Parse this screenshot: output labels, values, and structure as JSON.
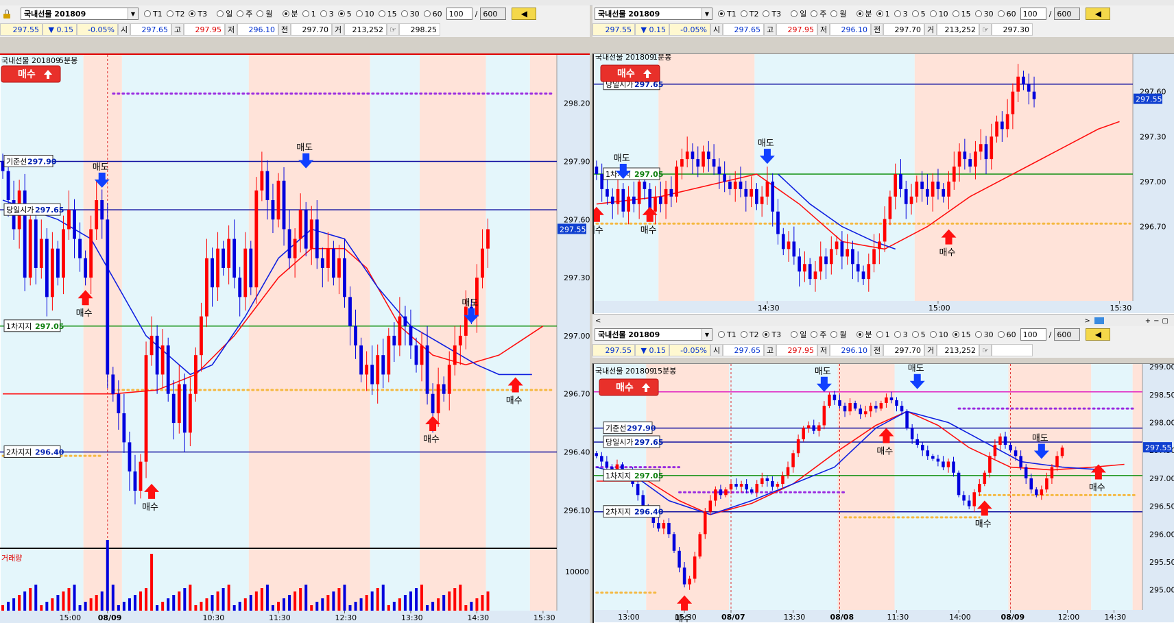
{
  "symbol": "국내선물 201809",
  "periods": [
    "T1",
    "T2",
    "T3",
    "일",
    "주",
    "월",
    "분",
    "1",
    "3",
    "5",
    "10",
    "15",
    "30",
    "60"
  ],
  "count": "100",
  "maxcount": "600",
  "quote": {
    "last": "297.55",
    "change": "▼ 0.15",
    "rate": "-0.05%",
    "open_label": "시",
    "open": "297.65",
    "high_label": "고",
    "high": "297.95",
    "low_label": "저",
    "low": "296.10",
    "prev_label": "전",
    "prev": "297.70",
    "vol_label": "거",
    "volume": "213,252"
  },
  "quote_extra_left": "298.25",
  "quote_extra_tr": "297.30",
  "buy_button": "매수",
  "sell_word": "매도",
  "buy_word": "매수",
  "volume_label": "거래량",
  "level_labels": {
    "base": {
      "name": "기준선",
      "value": "297.90"
    },
    "open": {
      "name": "당일시가",
      "value": "297.65"
    },
    "s1": {
      "name": "1차지지",
      "value": "297.05"
    },
    "s2": {
      "name": "2차지지",
      "value": "296.40"
    }
  },
  "charts": [
    {
      "id": "left",
      "title": "국내선물 201809",
      "interval": "5분봉",
      "selected_period": "5",
      "y_min": 295.85,
      "y_max": 298.45,
      "y_ticks": [
        "298.20",
        "297.90",
        "297.60",
        "297.30",
        "297.00",
        "296.70",
        "296.40",
        "296.10"
      ],
      "y_tick_values": [
        298.2,
        297.9,
        297.6,
        297.3,
        297.0,
        296.7,
        296.4,
        296.1
      ],
      "volume_tick": "10000",
      "x_labels": [
        {
          "text": "15:00",
          "i": 12
        },
        {
          "text": "08/09",
          "i": 19,
          "bold": true
        },
        {
          "text": "10:30",
          "i": 38
        },
        {
          "text": "11:30",
          "i": 50
        },
        {
          "text": "12:30",
          "i": 62
        },
        {
          "text": "13:30",
          "i": 74
        },
        {
          "text": "14:30",
          "i": 86
        },
        {
          "text": "15:30",
          "i": 98
        }
      ],
      "candles": [
        297.85,
        297.7,
        297.55,
        297.75,
        297.3,
        297.6,
        297.35,
        297.5,
        297.2,
        297.45,
        297.3,
        297.55,
        297.65,
        297.5,
        297.4,
        297.3,
        297.55,
        297.7,
        297.6,
        296.8,
        296.7,
        296.6,
        296.45,
        296.3,
        296.2,
        296.35,
        296.9,
        297.0,
        296.8,
        296.95,
        296.7,
        296.55,
        296.75,
        296.5,
        296.7,
        296.9,
        297.1,
        297.4,
        297.25,
        297.45,
        297.35,
        297.5,
        297.3,
        297.2,
        297.45,
        297.25,
        297.75,
        297.85,
        297.7,
        297.6,
        297.8,
        297.55,
        297.4,
        297.5,
        297.65,
        297.45,
        297.6,
        297.4,
        297.35,
        297.45,
        297.3,
        297.4,
        297.2,
        297.05,
        296.95,
        296.8,
        296.85,
        296.75,
        296.9,
        296.8,
        297.0,
        296.95,
        297.1,
        297.05,
        296.95,
        296.85,
        296.95,
        296.7,
        296.6,
        296.75,
        296.7,
        296.85,
        296.95,
        297.0,
        297.15,
        297.1,
        297.3,
        297.45,
        297.55
      ],
      "ma_red": [
        [
          0,
          296.7
        ],
        [
          20,
          296.7
        ],
        [
          28,
          296.72
        ],
        [
          35,
          296.8
        ],
        [
          42,
          297.0
        ],
        [
          50,
          297.3
        ],
        [
          56,
          297.45
        ],
        [
          62,
          297.45
        ],
        [
          66,
          297.35
        ],
        [
          72,
          297.05
        ],
        [
          78,
          296.9
        ],
        [
          84,
          296.85
        ],
        [
          90,
          296.9
        ],
        [
          98,
          297.05
        ]
      ],
      "ma_blue": [
        [
          0,
          297.7
        ],
        [
          10,
          297.6
        ],
        [
          16,
          297.5
        ],
        [
          22,
          297.2
        ],
        [
          26,
          297.0
        ],
        [
          30,
          296.9
        ],
        [
          34,
          296.8
        ],
        [
          38,
          296.85
        ],
        [
          44,
          297.1
        ],
        [
          50,
          297.4
        ],
        [
          56,
          297.55
        ],
        [
          62,
          297.5
        ],
        [
          68,
          297.25
        ],
        [
          74,
          297.05
        ],
        [
          80,
          296.95
        ],
        [
          86,
          296.85
        ],
        [
          90,
          296.8
        ],
        [
          96,
          296.8
        ]
      ],
      "levels": [
        {
          "key": "base",
          "y": 297.9,
          "color": "#1010a0"
        },
        {
          "key": "open",
          "y": 297.65,
          "color": "#1010a0"
        },
        {
          "key": "s1",
          "y": 297.05,
          "color": "#109010"
        },
        {
          "key": "s2",
          "y": 296.4,
          "color": "#1010a0"
        }
      ],
      "dotted": [
        {
          "y": 298.25,
          "color": "#9a2be0",
          "x0": 20,
          "x1": 100
        },
        {
          "y": 296.72,
          "color": "#f5b840",
          "x0": 20,
          "x1": 100
        },
        {
          "y": 296.38,
          "color": "#f5b840",
          "x0": 0,
          "x1": 18
        }
      ],
      "signals": [
        {
          "type": "sell",
          "i": 18,
          "y": 297.75
        },
        {
          "type": "sell",
          "i": 55,
          "y": 297.85
        },
        {
          "type": "sell",
          "i": 85,
          "y": 297.05
        },
        {
          "type": "buy",
          "i": 15,
          "y": 297.25
        },
        {
          "type": "buy",
          "i": 27,
          "y": 296.25
        },
        {
          "type": "buy",
          "i": 78,
          "y": 296.6
        },
        {
          "type": "buy",
          "i": 93,
          "y": 296.8
        }
      ],
      "last_price": {
        "value": 297.55,
        "text": "297.55"
      }
    },
    {
      "id": "tr",
      "title": "국내선물 201809",
      "interval": "1분봉",
      "selected_period": "1",
      "y_min": 296.25,
      "y_max": 297.85,
      "y_ticks": [
        "297.60",
        "297.30",
        "297.00",
        "296.70"
      ],
      "y_tick_values": [
        297.6,
        297.3,
        297.0,
        296.7
      ],
      "x_labels": [
        {
          "text": "14:30",
          "i": 32
        },
        {
          "text": "15:00",
          "i": 64
        },
        {
          "text": "15:30",
          "i": 98
        }
      ],
      "candles": [
        297.05,
        296.95,
        296.9,
        296.85,
        296.95,
        296.8,
        296.9,
        296.85,
        297.0,
        296.95,
        296.8,
        296.9,
        296.85,
        296.95,
        296.9,
        297.1,
        297.15,
        297.2,
        297.15,
        297.1,
        297.2,
        297.15,
        297.1,
        297.05,
        297.0,
        296.95,
        297.0,
        296.95,
        296.9,
        296.95,
        296.85,
        296.9,
        297.0,
        296.8,
        296.65,
        296.55,
        296.6,
        296.5,
        296.4,
        296.45,
        296.35,
        296.4,
        296.5,
        296.45,
        296.55,
        296.6,
        296.5,
        296.55,
        296.45,
        296.4,
        296.35,
        296.45,
        296.55,
        296.6,
        296.75,
        296.9,
        297.05,
        296.95,
        296.85,
        296.9,
        297.0,
        296.95,
        296.9,
        297.0,
        296.95,
        296.9,
        297.0,
        297.1,
        297.2,
        297.15,
        297.1,
        297.2,
        297.25,
        297.15,
        297.3,
        297.4,
        297.35,
        297.45,
        297.6,
        297.7,
        297.65,
        297.6,
        297.55
      ],
      "ma_red": [
        [
          0,
          296.85
        ],
        [
          12,
          296.9
        ],
        [
          24,
          297.0
        ],
        [
          30,
          297.05
        ],
        [
          38,
          296.85
        ],
        [
          46,
          296.6
        ],
        [
          54,
          296.55
        ],
        [
          62,
          296.7
        ],
        [
          70,
          296.9
        ],
        [
          78,
          297.05
        ],
        [
          86,
          297.2
        ],
        [
          94,
          297.35
        ],
        [
          98,
          297.4
        ]
      ],
      "ma_blue": [
        [
          34,
          297.05
        ],
        [
          40,
          296.85
        ],
        [
          46,
          296.7
        ],
        [
          52,
          296.6
        ],
        [
          56,
          296.55
        ]
      ],
      "levels": [
        {
          "key": "open",
          "y": 297.65,
          "color": "#1010a0"
        },
        {
          "key": "s1",
          "y": 297.05,
          "color": "#109010"
        }
      ],
      "dotted": [
        {
          "y": 296.72,
          "color": "#f5b840",
          "x0": 0,
          "x1": 100
        }
      ],
      "signals": [
        {
          "type": "sell",
          "i": 5,
          "y": 297.0
        },
        {
          "type": "sell",
          "i": 32,
          "y": 297.1
        },
        {
          "type": "buy",
          "i": 0,
          "y": 296.85
        },
        {
          "type": "buy",
          "i": 10,
          "y": 296.85
        },
        {
          "type": "buy",
          "i": 66,
          "y": 296.7
        }
      ],
      "last_price": {
        "value": 297.55,
        "text": "297.55"
      }
    },
    {
      "id": "br",
      "title": "국내선물 201809",
      "interval": "15분봉",
      "selected_period": "15",
      "y_min": 294.8,
      "y_max": 299.05,
      "y_ticks": [
        "299.00",
        "298.50",
        "298.00",
        "297.50",
        "297.00",
        "296.50",
        "296.00",
        "295.50",
        "295.00"
      ],
      "y_tick_values": [
        299.0,
        298.5,
        298.0,
        297.5,
        297.0,
        296.5,
        296.0,
        295.5,
        295.0
      ],
      "x_labels": [
        {
          "text": "13:00",
          "i": 6
        },
        {
          "text": "15:30",
          "i": 17
        },
        {
          "text": "08/07",
          "i": 26,
          "bold": true
        },
        {
          "text": "13:30",
          "i": 38
        },
        {
          "text": "08/08",
          "i": 47,
          "bold": true
        },
        {
          "text": "11:30",
          "i": 58
        },
        {
          "text": "14:00",
          "i": 70
        },
        {
          "text": "08/09",
          "i": 80,
          "bold": true
        },
        {
          "text": "12:00",
          "i": 91
        },
        {
          "text": "14:30",
          "i": 100
        }
      ],
      "candles": [
        297.4,
        297.3,
        297.2,
        297.15,
        297.25,
        297.05,
        297.1,
        296.9,
        296.7,
        296.5,
        296.4,
        296.2,
        296.1,
        296.2,
        296.0,
        295.7,
        295.4,
        295.1,
        295.2,
        295.6,
        296.0,
        296.4,
        296.6,
        296.8,
        296.7,
        296.8,
        296.9,
        296.85,
        296.9,
        296.8,
        296.75,
        296.9,
        297.0,
        296.95,
        296.85,
        296.9,
        297.05,
        297.2,
        297.45,
        297.7,
        297.9,
        297.95,
        297.85,
        297.95,
        298.3,
        298.5,
        298.4,
        298.3,
        298.2,
        298.35,
        298.25,
        298.15,
        298.2,
        298.3,
        298.25,
        298.35,
        298.45,
        298.4,
        298.3,
        298.2,
        297.9,
        297.7,
        297.6,
        297.5,
        297.4,
        297.35,
        297.3,
        297.2,
        297.3,
        297.1,
        296.7,
        296.6,
        296.5,
        296.75,
        296.9,
        297.1,
        297.4,
        297.6,
        297.75,
        297.6,
        297.5,
        297.4,
        297.2,
        297.0,
        296.8,
        296.7,
        296.8,
        297.0,
        297.2,
        297.4,
        297.55
      ],
      "ma_red": [
        [
          0,
          296.95
        ],
        [
          10,
          296.95
        ],
        [
          16,
          296.6
        ],
        [
          22,
          296.35
        ],
        [
          30,
          296.55
        ],
        [
          38,
          296.9
        ],
        [
          46,
          297.45
        ],
        [
          54,
          297.95
        ],
        [
          60,
          298.2
        ],
        [
          66,
          297.95
        ],
        [
          72,
          297.55
        ],
        [
          80,
          297.2
        ],
        [
          88,
          297.15
        ],
        [
          96,
          297.2
        ],
        [
          102,
          297.25
        ]
      ],
      "ma_blue": [
        [
          0,
          297.2
        ],
        [
          8,
          297.0
        ],
        [
          14,
          296.6
        ],
        [
          22,
          296.35
        ],
        [
          30,
          296.6
        ],
        [
          38,
          296.9
        ],
        [
          46,
          297.2
        ],
        [
          54,
          297.9
        ],
        [
          60,
          298.2
        ],
        [
          68,
          298.0
        ],
        [
          74,
          297.7
        ],
        [
          82,
          297.3
        ],
        [
          90,
          297.2
        ],
        [
          98,
          297.15
        ]
      ],
      "levels": [
        {
          "key": "base",
          "y": 297.9,
          "color": "#1010a0"
        },
        {
          "key": "open",
          "y": 297.65,
          "color": "#1010a0"
        },
        {
          "key": "s1",
          "y": 297.05,
          "color": "#109010"
        },
        {
          "key": "s2",
          "y": 296.4,
          "color": "#1010a0"
        }
      ],
      "solid_extra": [
        {
          "y": 298.55,
          "color": "#e020c0"
        }
      ],
      "dotted": [
        {
          "y": 298.25,
          "color": "#9a2be0",
          "x0": 70,
          "x1": 104
        },
        {
          "y": 296.75,
          "color": "#9a2be0",
          "x0": 16,
          "x1": 48
        },
        {
          "y": 297.2,
          "color": "#9a2be0",
          "x0": 0,
          "x1": 16
        },
        {
          "y": 296.3,
          "color": "#f5b840",
          "x0": 48,
          "x1": 74
        },
        {
          "y": 296.7,
          "color": "#f5b840",
          "x0": 74,
          "x1": 104
        },
        {
          "y": 294.95,
          "color": "#f5b840",
          "x0": 0,
          "x1": 12
        }
      ],
      "signals": [
        {
          "type": "sell",
          "i": 44,
          "y": 298.5
        },
        {
          "type": "sell",
          "i": 62,
          "y": 298.55
        },
        {
          "type": "sell",
          "i": 86,
          "y": 297.3
        },
        {
          "type": "buy",
          "i": 17,
          "y": 294.95
        },
        {
          "type": "buy",
          "i": 56,
          "y": 297.95
        },
        {
          "type": "buy",
          "i": 75,
          "y": 296.65
        },
        {
          "type": "buy",
          "i": 97,
          "y": 297.3
        }
      ],
      "last_price": {
        "value": 297.55,
        "text": "297.55"
      }
    }
  ]
}
